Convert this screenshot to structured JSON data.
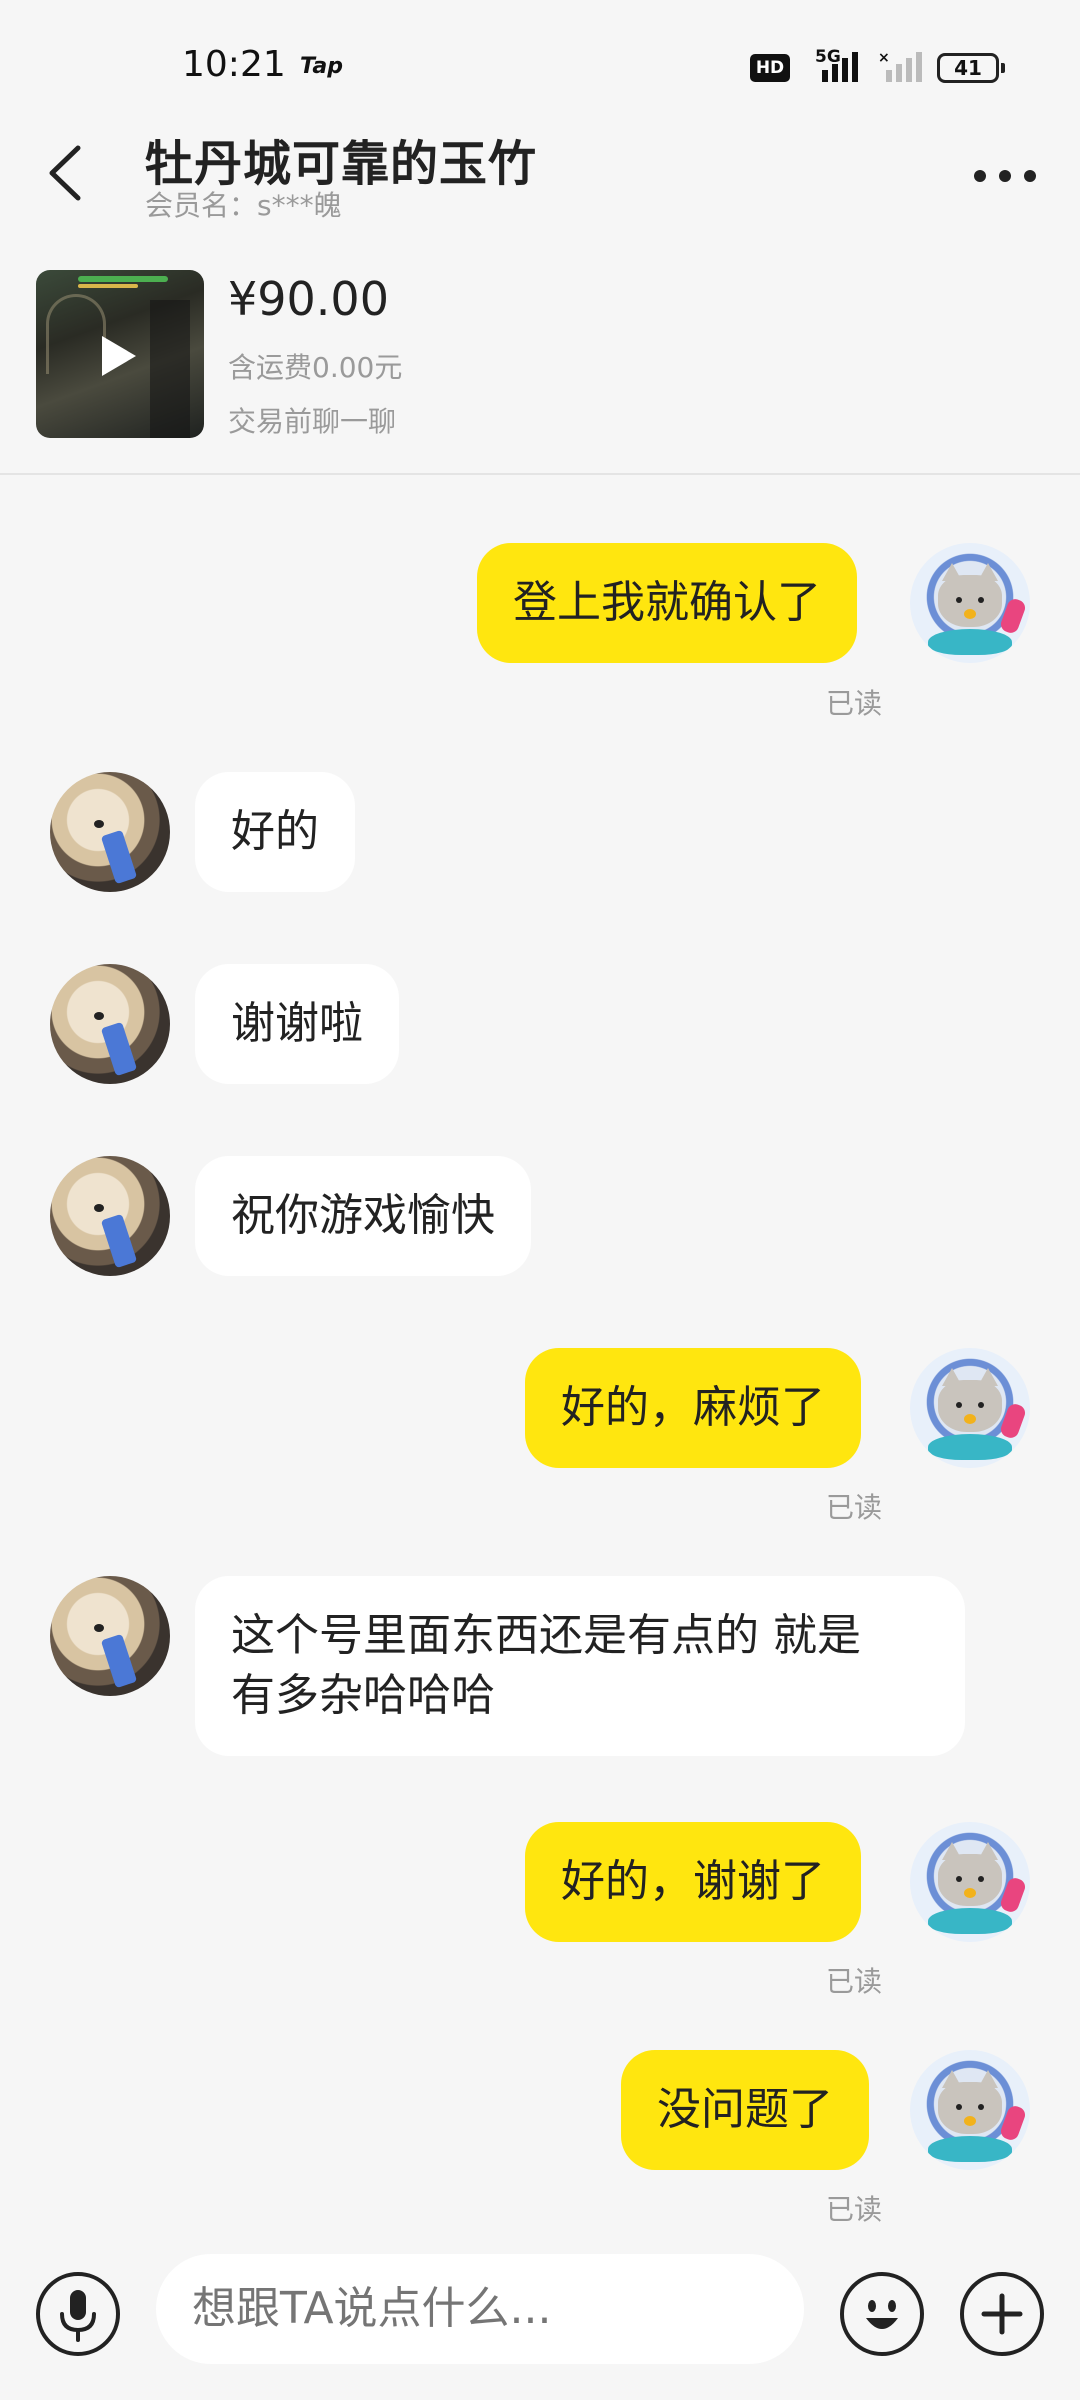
{
  "status_bar": {
    "time": "10:21",
    "app_badge": "Tap",
    "hd_label": "HD",
    "network": "5G",
    "battery": "41"
  },
  "header": {
    "title": "牡丹城可靠的玉竹",
    "member_name": "会员名：s***魄",
    "back_icon": "chevron-left-icon",
    "more_icon": "more-horizontal-icon"
  },
  "product": {
    "price": "¥90.00",
    "shipping": "含运费0.00元",
    "note": "交易前聊一聊",
    "media_icon": "play-icon"
  },
  "messages": [
    {
      "sender": "me",
      "text": "登上我就确认了",
      "status": "已读"
    },
    {
      "sender": "other",
      "text": "好的"
    },
    {
      "sender": "other",
      "text": "谢谢啦"
    },
    {
      "sender": "other",
      "text": "祝你游戏愉快"
    },
    {
      "sender": "me",
      "text": "好的，麻烦了",
      "status": "已读"
    },
    {
      "sender": "other",
      "text_line1": "这个号里面东西还是有点的 就是",
      "text_line2": "有多杂哈哈哈"
    },
    {
      "sender": "me",
      "text": "好的，谢谢了",
      "status": "已读"
    },
    {
      "sender": "me",
      "text": "没问题了",
      "status": "已读"
    }
  ],
  "input_bar": {
    "placeholder": "想跟TA说点什么...",
    "voice_icon": "microphone-icon",
    "emoji_icon": "emoji-icon",
    "plus_icon": "plus-icon"
  },
  "colors": {
    "my_bubble": "#ffe60f",
    "other_bubble": "#ffffff",
    "background": "#f6f6f6",
    "muted_text": "#9a9a9a"
  }
}
